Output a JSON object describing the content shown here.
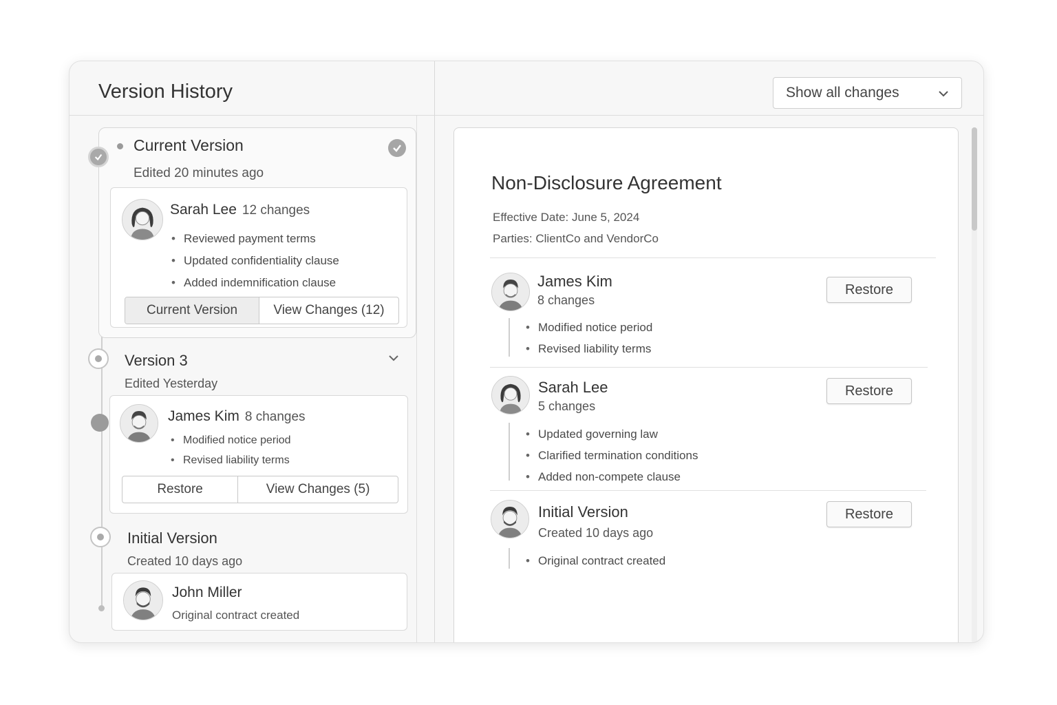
{
  "header": {
    "title": "Version History",
    "filter": {
      "selected": "Show all changes"
    }
  },
  "timeline": {
    "current": {
      "title": "Current Version",
      "edited": "Edited 20 minutes ago",
      "author": "Sarah Lee",
      "changes": "12 changes",
      "bullets": [
        "Reviewed payment terms",
        "Updated confidentiality clause",
        "Added indemnification clause"
      ],
      "buttons": {
        "primary": "Current Version",
        "secondary": "View Changes (12)"
      }
    },
    "version3": {
      "title": "Version 3",
      "edited": "Edited Yesterday",
      "author": "James Kim",
      "changes": "8 changes",
      "bullets": [
        "Modified notice period",
        "Revised liability terms"
      ],
      "buttons": {
        "primary": "Restore",
        "secondary": "View Changes (5)"
      }
    },
    "initial": {
      "title": "Initial Version",
      "created": "Created 10 days ago",
      "author": "John Miller",
      "note": "Original contract created"
    }
  },
  "document": {
    "title": "Non-Disclosure Agreement",
    "effective_date": "Effective Date: June 5, 2024",
    "parties": "Parties: ClientCo and VendorCo",
    "entries": [
      {
        "name": "James Kim",
        "sub": "8 changes",
        "bullets": [
          "Modified notice period",
          "Revised liability terms"
        ],
        "action": "Restore"
      },
      {
        "name": "Sarah Lee",
        "sub": "5 changes",
        "bullets": [
          "Updated governing law",
          "Clarified termination conditions",
          "Added non-compete clause"
        ],
        "action": "Restore"
      },
      {
        "name": "Initial Version",
        "sub": "Created 10 days ago",
        "bullets": [
          "Original contract created"
        ],
        "action": "Restore"
      }
    ]
  },
  "icons": {
    "filter_chevron": "chevron-down-icon",
    "collapse": "chevron-down-icon",
    "check": "check-icon",
    "avatar": "avatar-icon"
  },
  "colors": {
    "accent": "#9b9b9b",
    "border": "#d6d6d6",
    "background": "#f7f7f7"
  }
}
